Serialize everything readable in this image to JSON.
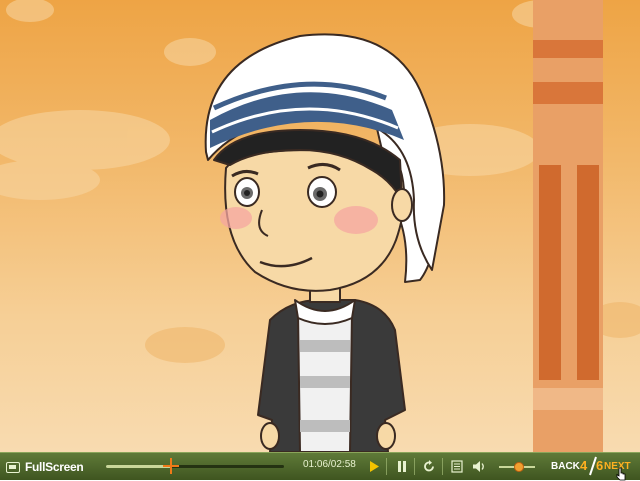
{
  "scene": {
    "character": "Mother Teresa cartoon figure"
  },
  "player": {
    "fullscreen_label": "FullScreen",
    "progress": 0.364,
    "time_display": "01:06/02:58",
    "volume": 0.55,
    "icons": [
      "fullscreen-icon",
      "play-icon",
      "pause-icon",
      "replay-icon",
      "subtitles-icon",
      "speaker-icon"
    ],
    "colors": {
      "bar": "#4f6a2c",
      "accent": "#f07a18",
      "page": "#ffb020"
    }
  },
  "pager": {
    "back_label": "BACK",
    "current": "4",
    "total": "6",
    "next_label": "NEXT"
  }
}
